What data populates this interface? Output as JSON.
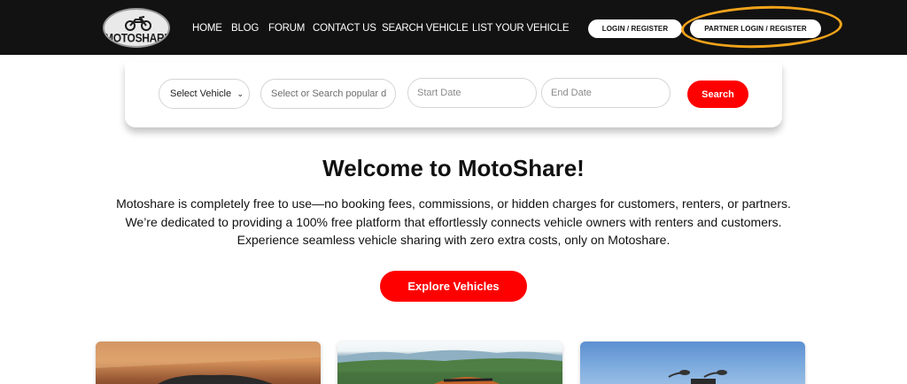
{
  "brand": {
    "name": "MOTOSHARE"
  },
  "nav": {
    "items": [
      "HOME",
      "BLOG",
      "FORUM",
      "CONTACT US",
      "SEARCH VEHICLE",
      "LIST YOUR VEHICLE"
    ]
  },
  "auth": {
    "login_label": "LOGIN / REGISTER",
    "partner_label": "PARTNER LOGIN / REGISTER",
    "highlight_color": "#f2a31b"
  },
  "search": {
    "vehicle_select_value": "Select Vehicle",
    "area_placeholder": "Select or Search  popular d",
    "start_date_placeholder": "Start Date",
    "end_date_placeholder": "End Date",
    "button_label": "Search"
  },
  "welcome": {
    "title": "Welcome to MotoShare!",
    "lines": [
      "Motoshare is completely free to use—no booking fees, commissions, or hidden charges for customers, renters, or partners.",
      "We’re dedicated to providing a 100% free platform that effortlessly connects vehicle owners with renters and customers.",
      "Experience seamless vehicle sharing with zero extra costs, only on Motoshare."
    ],
    "cta_label": "Explore Vehicles"
  },
  "colors": {
    "accent": "#ff0000",
    "header_bg": "#121212"
  },
  "icons": {
    "logo": "motorcycle-logo-icon",
    "dropdown": "chevron-down-icon"
  }
}
